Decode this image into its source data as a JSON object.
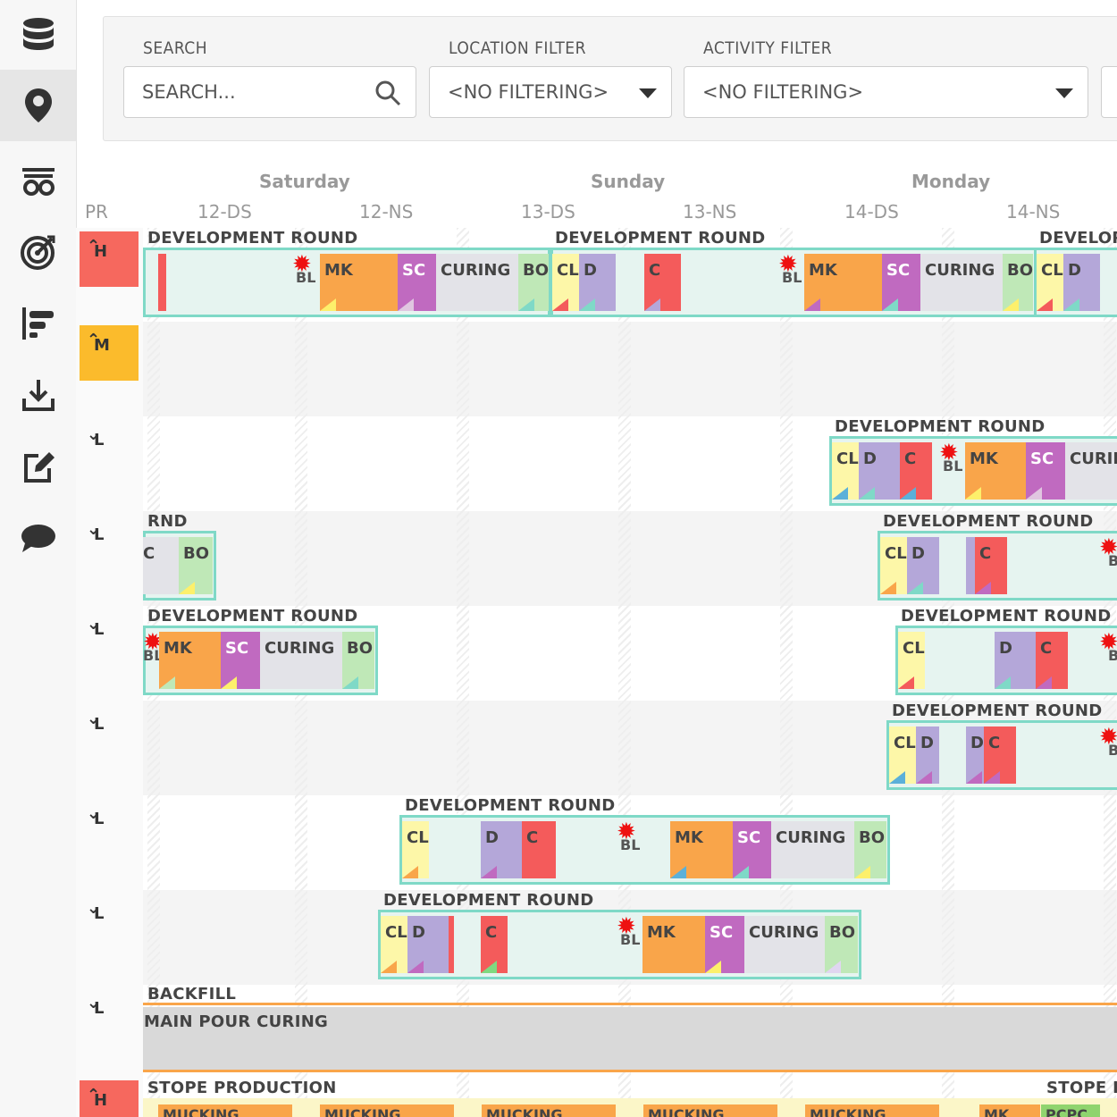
{
  "sidebar": {
    "icons": [
      "database-icon",
      "location-pin-icon",
      "cart-icon",
      "target-icon",
      "gantt-icon",
      "download-icon",
      "edit-icon",
      "chat-icon"
    ]
  },
  "filters": {
    "search_label": "SEARCH",
    "search_placeholder": "SEARCH...",
    "location_label": "LOCATION FILTER",
    "location_value": "<NO FILTERING>",
    "activity_label": "ACTIVITY FILTER",
    "activity_value": "<NO FILTERING>"
  },
  "timeline": {
    "pr_header": "PR",
    "days": [
      "Saturday",
      "Sunday",
      "Monday"
    ],
    "shifts": [
      "12-DS",
      "12-NS",
      "13-DS",
      "13-NS",
      "14-DS",
      "14-NS"
    ]
  },
  "rows": [
    {
      "priority": "H",
      "arrow": "≪",
      "color": "#f6685e"
    },
    {
      "priority": "M",
      "arrow": "^",
      "color": "#fbbb2c"
    },
    {
      "priority": "L",
      "arrow": "v",
      "color": ""
    },
    {
      "priority": "L",
      "arrow": "v",
      "color": ""
    },
    {
      "priority": "L",
      "arrow": "v",
      "color": ""
    },
    {
      "priority": "L",
      "arrow": "v",
      "color": ""
    },
    {
      "priority": "L",
      "arrow": "v",
      "color": ""
    },
    {
      "priority": "L",
      "arrow": "v",
      "color": ""
    },
    {
      "priority": "L",
      "arrow": "v",
      "color": ""
    },
    {
      "priority": "H",
      "arrow": "≪",
      "color": "#f6685e"
    }
  ],
  "labels": {
    "dev_round": "DEVELOPMENT ROUND",
    "dev_round_trunc": "DEVELOP",
    "dev_round_partial": "RND",
    "backfill": "BACKFILL",
    "main_pour": "MAIN POUR CURING",
    "stope": "STOPE PRODUCTION",
    "stope_trunc": "STOPE P",
    "mucking": "MUCKING",
    "mk": "MK",
    "sc": "SC",
    "curing": "CURING",
    "curin_trunc": "CURIN",
    "bo": "BO",
    "cl": "CL",
    "d": "D",
    "c": "C",
    "bl": "BL",
    "pcpc": "PCPC"
  },
  "colors": {
    "cl": "#fdf7a8",
    "d": "#b4a7d9",
    "c": "#f45b5b",
    "mk": "#f9a54a",
    "sc": "#c06ac0",
    "curing": "#e3e3e8",
    "bo": "#bfe8b7",
    "group_border": "#7fd9c7",
    "group_bg": "#e6f4f0",
    "backfill_line": "#f9a54a"
  }
}
